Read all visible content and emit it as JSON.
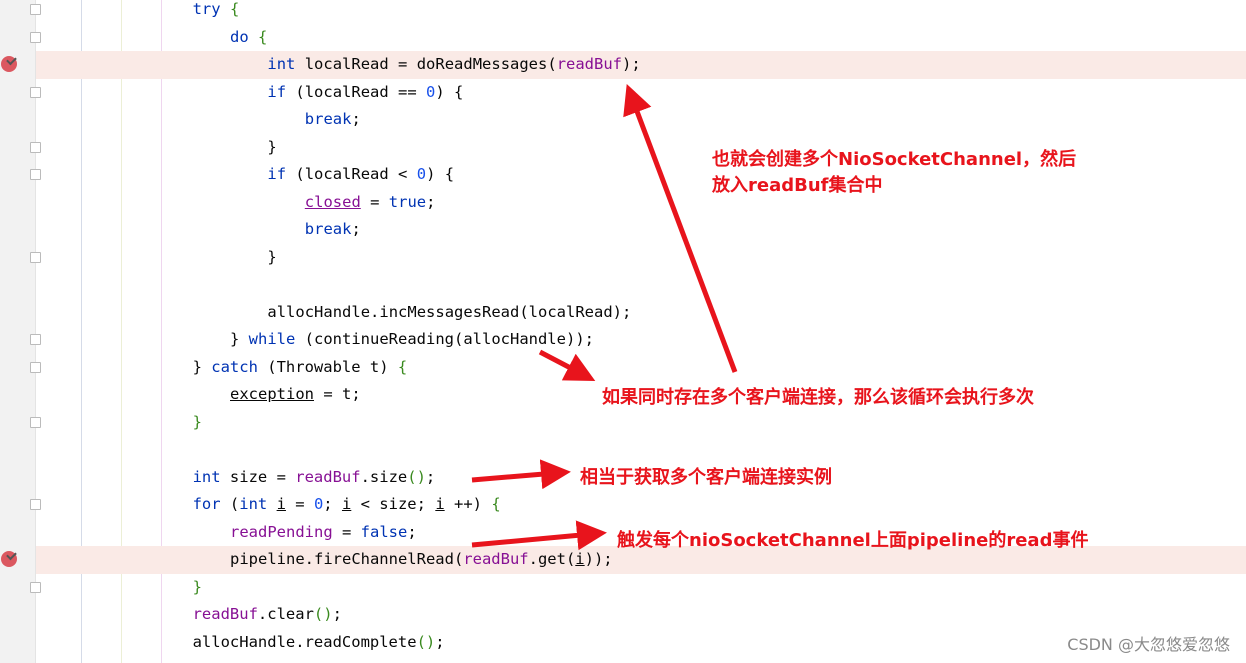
{
  "editor": {
    "colors": {
      "keyword": "#0033b3",
      "field": "#871094",
      "number": "#1750eb",
      "text": "#080808",
      "highlight": "#faeae6",
      "annotation": "#e8141c"
    },
    "breakpoint_lines": [
      2,
      20
    ],
    "highlight_lines": [
      2,
      20
    ],
    "lines": [
      {
        "indent": 4,
        "tokens": [
          [
            "try",
            "kw"
          ],
          [
            " "
          ],
          [
            "{",
            "br"
          ]
        ]
      },
      {
        "indent": 5,
        "tokens": [
          [
            "do",
            "kw"
          ],
          [
            " "
          ],
          [
            "{",
            "br"
          ]
        ]
      },
      {
        "indent": 6,
        "tokens": [
          [
            "int",
            "kw"
          ],
          [
            " localRead = doReadMessages("
          ],
          [
            "readBuf",
            "fld"
          ],
          [
            ");"
          ]
        ]
      },
      {
        "indent": 6,
        "tokens": [
          [
            "if",
            "kw"
          ],
          [
            " (localRead == "
          ],
          [
            "0",
            "num"
          ],
          [
            ") {"
          ]
        ]
      },
      {
        "indent": 7,
        "tokens": [
          [
            "break",
            "kw"
          ],
          [
            ";"
          ]
        ]
      },
      {
        "indent": 6,
        "tokens": [
          [
            "}"
          ]
        ]
      },
      {
        "indent": 6,
        "tokens": [
          [
            "if",
            "kw"
          ],
          [
            " (localRead < "
          ],
          [
            "0",
            "num"
          ],
          [
            ") {"
          ]
        ]
      },
      {
        "indent": 7,
        "tokens": [
          [
            "closed",
            "fld ul"
          ],
          [
            " = "
          ],
          [
            "true",
            "kw"
          ],
          [
            ";"
          ]
        ]
      },
      {
        "indent": 7,
        "tokens": [
          [
            "break",
            "kw"
          ],
          [
            ";"
          ]
        ]
      },
      {
        "indent": 6,
        "tokens": [
          [
            "}"
          ]
        ]
      },
      {
        "indent": 0,
        "tokens": []
      },
      {
        "indent": 6,
        "tokens": [
          [
            "allocHandle.incMessagesRead(localRead);"
          ]
        ]
      },
      {
        "indent": 5,
        "tokens": [
          [
            "} "
          ],
          [
            "while",
            "kw"
          ],
          [
            " ("
          ],
          [
            "continueReading(allocHandle)"
          ],
          [
            ");"
          ]
        ]
      },
      {
        "indent": 4,
        "tokens": [
          [
            "} "
          ],
          [
            "catch",
            "kw"
          ],
          [
            " (Throwable t) "
          ],
          [
            "{",
            "br"
          ]
        ]
      },
      {
        "indent": 5,
        "tokens": [
          [
            "exception",
            "ul"
          ],
          [
            " = t;"
          ]
        ]
      },
      {
        "indent": 4,
        "tokens": [
          [
            "}",
            "br"
          ]
        ]
      },
      {
        "indent": 0,
        "tokens": []
      },
      {
        "indent": 4,
        "tokens": [
          [
            "int",
            "kw"
          ],
          [
            " size = "
          ],
          [
            "readBuf",
            "fld"
          ],
          [
            ".size"
          ],
          [
            "()",
            "br"
          ],
          [
            ";"
          ]
        ]
      },
      {
        "indent": 4,
        "tokens": [
          [
            "for",
            "kw"
          ],
          [
            " ("
          ],
          [
            "int",
            "kw"
          ],
          [
            " "
          ],
          [
            "i",
            "ul"
          ],
          [
            " = "
          ],
          [
            "0",
            "num"
          ],
          [
            "; "
          ],
          [
            "i",
            "ul"
          ],
          [
            " < size; "
          ],
          [
            "i",
            "ul"
          ],
          [
            " ++) "
          ],
          [
            "{",
            "br"
          ]
        ]
      },
      {
        "indent": 5,
        "tokens": [
          [
            "readPending",
            "fld"
          ],
          [
            " = "
          ],
          [
            "false",
            "kw"
          ],
          [
            ";"
          ]
        ]
      },
      {
        "indent": 5,
        "tokens": [
          [
            "pipeline.fireChannelRead("
          ],
          [
            "readBuf",
            "fld"
          ],
          [
            ".get("
          ],
          [
            "i",
            "ul"
          ],
          [
            "));"
          ]
        ]
      },
      {
        "indent": 4,
        "tokens": [
          [
            "}",
            "br"
          ]
        ]
      },
      {
        "indent": 4,
        "tokens": [
          [
            "readBuf",
            "fld"
          ],
          [
            ".clear"
          ],
          [
            "()",
            "br"
          ],
          [
            ";"
          ]
        ]
      },
      {
        "indent": 4,
        "tokens": [
          [
            "allocHandle.readComplete"
          ],
          [
            "()",
            "br"
          ],
          [
            ";"
          ]
        ]
      }
    ],
    "fold_lines": [
      0,
      1,
      3,
      5,
      6,
      9,
      12,
      13,
      15,
      18,
      21
    ]
  },
  "annotations": {
    "note1_line1": "也就会创建多个NioSocketChannel，然后",
    "note1_line2": "放入readBuf集合中",
    "note2": "如果同时存在多个客户端连接，那么该循环会执行多次",
    "note3": "相当于获取多个客户端连接实例",
    "note4": "触发每个nioSocketChannel上面pipeline的read事件"
  },
  "watermark": "CSDN @大忽悠爱忽悠"
}
